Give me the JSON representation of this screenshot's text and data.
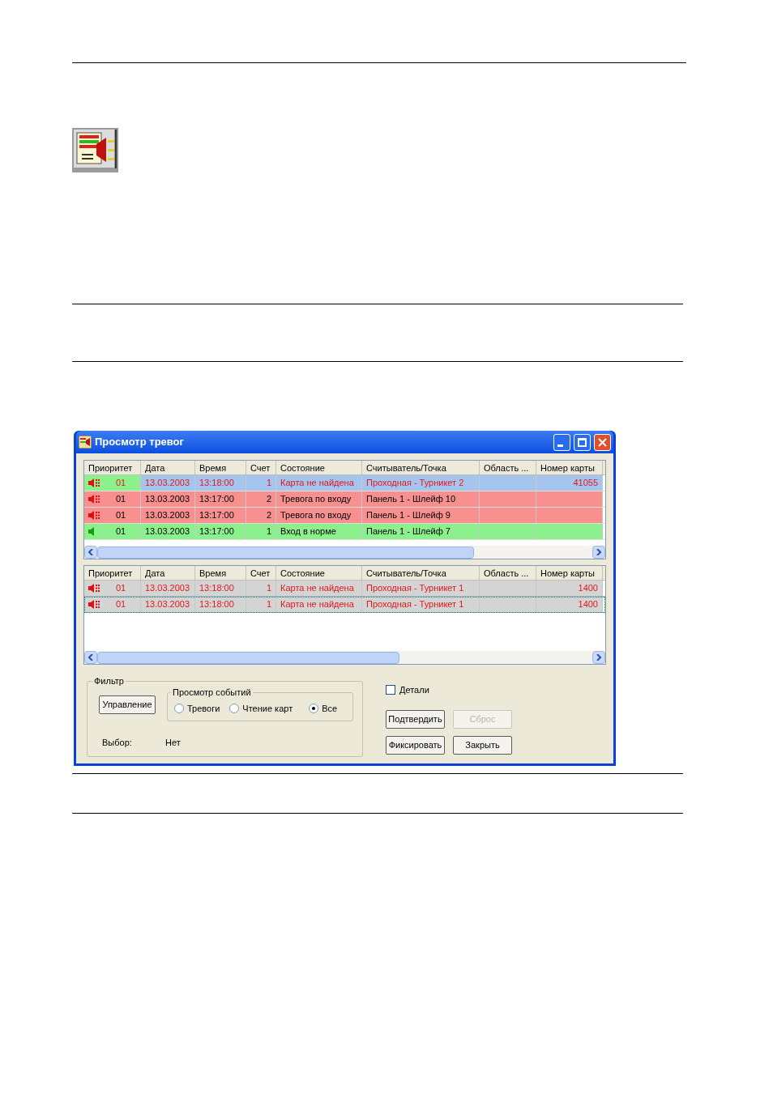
{
  "window": {
    "title": "Просмотр тревог"
  },
  "alarms_table": {
    "columns": [
      "Приоритет",
      "Дата",
      "Время",
      "Счет",
      "Состояние",
      "Считыватель/Точка",
      "Область ...",
      "Номер карты"
    ],
    "rows": [
      {
        "alarm": true,
        "kind": "card",
        "color": "#8cf08c",
        "selected": true,
        "focused": false,
        "cells": [
          "01",
          "13.03.2003",
          "13:18:00",
          "1",
          "Карта не найдена",
          "Проходная - Турникет 2",
          "",
          "41055"
        ]
      },
      {
        "alarm": true,
        "kind": "panel",
        "color": "#f89090",
        "selected": false,
        "focused": false,
        "cells": [
          "01",
          "13.03.2003",
          "13:17:00",
          "2",
          "Тревога по входу",
          "Панель 1 - Шлейф 10",
          "",
          ""
        ]
      },
      {
        "alarm": true,
        "kind": "panel",
        "color": "#f89090",
        "selected": false,
        "focused": false,
        "cells": [
          "01",
          "13.03.2003",
          "13:17:00",
          "2",
          "Тревога по входу",
          "Панель 1 - Шлейф 9",
          "",
          ""
        ]
      },
      {
        "alarm": false,
        "kind": "panel",
        "color": "#8cf08c",
        "selected": false,
        "focused": false,
        "cells": [
          "01",
          "13.03.2003",
          "13:17:00",
          "1",
          "Вход в норме",
          "Панель 1 - Шлейф 7",
          "",
          ""
        ]
      }
    ]
  },
  "events_table": {
    "columns": [
      "Приоритет",
      "Дата",
      "Время",
      "Счет",
      "Состояние",
      "Считыватель/Точка",
      "Область ...",
      "Номер карты"
    ],
    "rows": [
      {
        "alarm": true,
        "kind": "card",
        "color": "#d4d4d4",
        "selected": false,
        "focused": false,
        "cells": [
          "01",
          "13.03.2003",
          "13:18:00",
          "1",
          "Карта не найдена",
          "Проходная - Турникет 1",
          "",
          "1400"
        ]
      },
      {
        "alarm": true,
        "kind": "card",
        "color": "#d4d4d4",
        "selected": false,
        "focused": true,
        "cells": [
          "01",
          "13.03.2003",
          "13:18:00",
          "1",
          "Карта не найдена",
          "Проходная - Турникет 1",
          "",
          "1400"
        ]
      }
    ]
  },
  "filter": {
    "title": "Фильтр",
    "manage_button": "Управление",
    "view_group": {
      "title": "Просмотр событий",
      "options": [
        {
          "label": "Тревоги",
          "selected": false
        },
        {
          "label": "Чтение карт",
          "selected": false
        },
        {
          "label": "Все",
          "selected": true
        }
      ]
    },
    "choice_label": "Выбор:",
    "choice_value": "Нет"
  },
  "details": {
    "label": "Детали",
    "checked": false
  },
  "buttons": [
    {
      "label": "Подтвердить",
      "disabled": false
    },
    {
      "label": "Сброс",
      "disabled": true
    },
    {
      "label": "Фиксировать",
      "disabled": false
    },
    {
      "label": "Закрыть",
      "disabled": false
    }
  ]
}
